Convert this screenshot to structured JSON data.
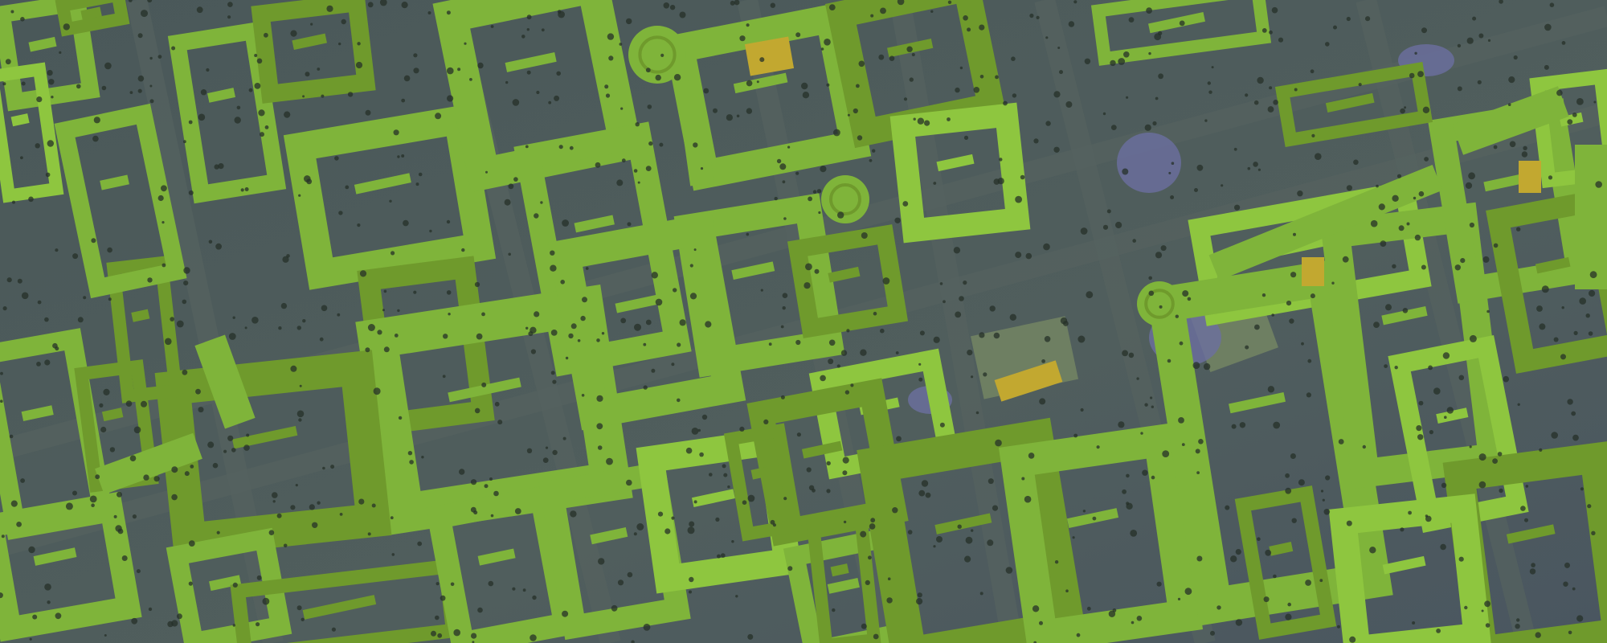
{
  "map": {
    "view": "shaded-relief-elevation-map",
    "colors": {
      "ground": "#4d5c5d",
      "road": "#56625f",
      "tree": "#263028",
      "building_low": "#6f9a2c",
      "building_mid": "#7fb43a",
      "building_high": "#8ec63f",
      "building_highlight": "#c2a830",
      "water_depression": "#6c6fa0",
      "plaza": "#6e7f62"
    },
    "features": [
      {
        "kind": "building",
        "tier": "mid"
      },
      {
        "kind": "building",
        "tier": "high"
      },
      {
        "kind": "building",
        "tier": "highlight"
      },
      {
        "kind": "plaza"
      },
      {
        "kind": "depression"
      },
      {
        "kind": "rotunda"
      },
      {
        "kind": "tree-cluster"
      }
    ]
  }
}
